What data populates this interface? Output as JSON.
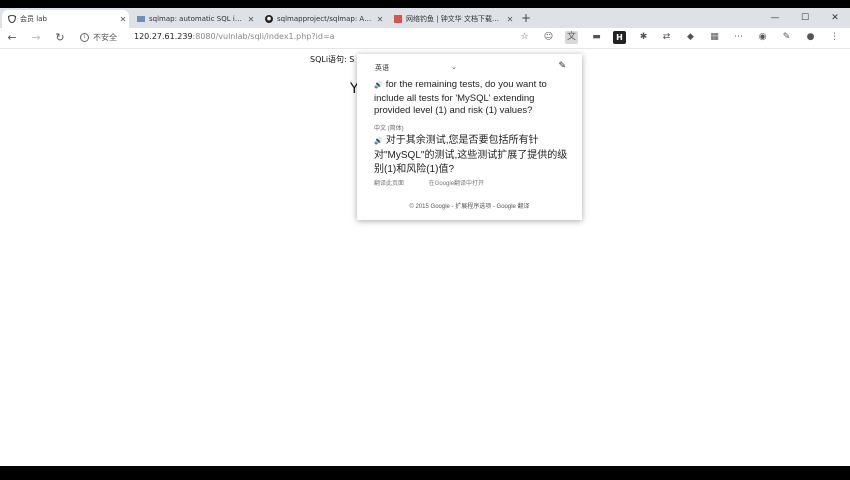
{
  "tabs": [
    {
      "title": "会员 lab",
      "active": true,
      "icon": "shield-icon"
    },
    {
      "title": "sqlmap: automatic SQL injectio",
      "active": false,
      "icon": "sqlmap-icon"
    },
    {
      "title": "sqlmapproject/sqlmap: Automat",
      "active": false,
      "icon": "github-icon"
    },
    {
      "title": "网络钓鱼 | 钟文华 文档下载不同",
      "active": false,
      "icon": "doc-icon"
    }
  ],
  "toolbar": {
    "security_label": "不安全",
    "url_host": "120.27.61.239",
    "url_rest": ":8080/vulnlab/sqli/index1.php?id=a"
  },
  "page": {
    "sql_label": "SQLi语句: S",
    "big_text": "Y"
  },
  "translate_popup": {
    "source_language": "英语",
    "source_text": "for the remaining tests, do you want to include all tests for 'MySQL' extending provided level (1) and risk (1) values?",
    "target_language": "中文 (简体)",
    "target_text": "对于其余测试,您是否要包括所有针对\"MySQL\"的测试,这些测试扩展了提供的级别(1)和风险(1)值?",
    "link_translate_page": "翻译此页面",
    "link_open_google": "在Google翻译中打开",
    "footer": "© 2015 Google - 扩展程序选项 - Google 翻译"
  }
}
